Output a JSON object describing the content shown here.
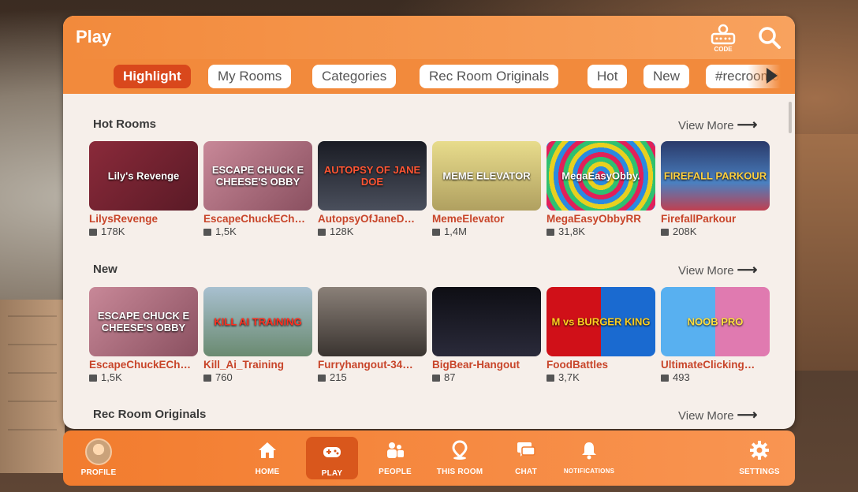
{
  "header": {
    "title": "Play",
    "code_label": "CODE"
  },
  "tabs": [
    {
      "label": "Highlight",
      "active": true
    },
    {
      "label": "My Rooms"
    },
    {
      "label": "Categories"
    },
    {
      "label": "Rec Room Originals"
    },
    {
      "label": "Hot"
    },
    {
      "label": "New"
    },
    {
      "label": "#recroomo"
    }
  ],
  "sections": {
    "hot": {
      "title": "Hot Rooms",
      "view_more": "View More",
      "rooms": [
        {
          "name": "LilysRevenge",
          "likes": "178K",
          "thumb_text": "Lily's Revenge",
          "color": "#7a2433"
        },
        {
          "name": "EscapeChuckECh…",
          "likes": "1,5K",
          "thumb_text": "ESCAPE CHUCK E CHEESE'S OBBY",
          "color": "#b06070"
        },
        {
          "name": "AutopsyOfJaneD…",
          "likes": "128K",
          "thumb_text": "AUTOPSY OF JANE DOE",
          "color": "#2a2d36"
        },
        {
          "name": "MemeElevator",
          "likes": "1,4M",
          "thumb_text": "MEME ELEVATOR",
          "color": "#d9c978"
        },
        {
          "name": "MegaEasyObbyRR",
          "likes": "31,8K",
          "thumb_text": "MegaEasyObby.",
          "color": "#7a3cc0"
        },
        {
          "name": "FirefallParkour",
          "likes": "208K",
          "thumb_text": "FIREFALL PARKOUR",
          "color": "#3a6ea8"
        }
      ]
    },
    "new": {
      "title": "New",
      "view_more": "View More",
      "rooms": [
        {
          "name": "EscapeChuckECh…",
          "likes": "1,5K",
          "thumb_text": "ESCAPE CHUCK E CHEESE'S OBBY",
          "color": "#b06070"
        },
        {
          "name": "Kill_Ai_Training",
          "likes": "760",
          "thumb_text": "KILL AI TRAINING",
          "color": "#3d8a4a"
        },
        {
          "name": "Furryhangout-34…",
          "likes": "215",
          "thumb_text": "",
          "color": "#5d5148"
        },
        {
          "name": "BigBear-Hangout",
          "likes": "87",
          "thumb_text": "",
          "color": "#1c1c24"
        },
        {
          "name": "FoodBattles",
          "likes": "3,7K",
          "thumb_text": "M vs BURGER KING",
          "color": "#c4121c"
        },
        {
          "name": "UltimateClicking…",
          "likes": "493",
          "thumb_text": "NOOB PRO",
          "color": "#4aa0e0"
        }
      ]
    },
    "originals": {
      "title": "Rec Room Originals",
      "view_more": "View More"
    }
  },
  "nav": [
    {
      "label": "PROFILE",
      "icon": "avatar"
    },
    {
      "label": "HOME",
      "icon": "home-icon"
    },
    {
      "label": "PLAY",
      "icon": "gamepad-icon",
      "active": true
    },
    {
      "label": "PEOPLE",
      "icon": "people-icon"
    },
    {
      "label": "THIS ROOM",
      "icon": "location-pin-icon"
    },
    {
      "label": "CHAT",
      "icon": "chat-icon"
    },
    {
      "label": "NOTIFICATIONS",
      "icon": "bell-icon"
    },
    {
      "label": "SETTINGS",
      "icon": "gear-icon"
    }
  ],
  "colors": {
    "accent": "#f28a3c",
    "active_tab": "#d9481c",
    "room_name": "#c8452a"
  }
}
